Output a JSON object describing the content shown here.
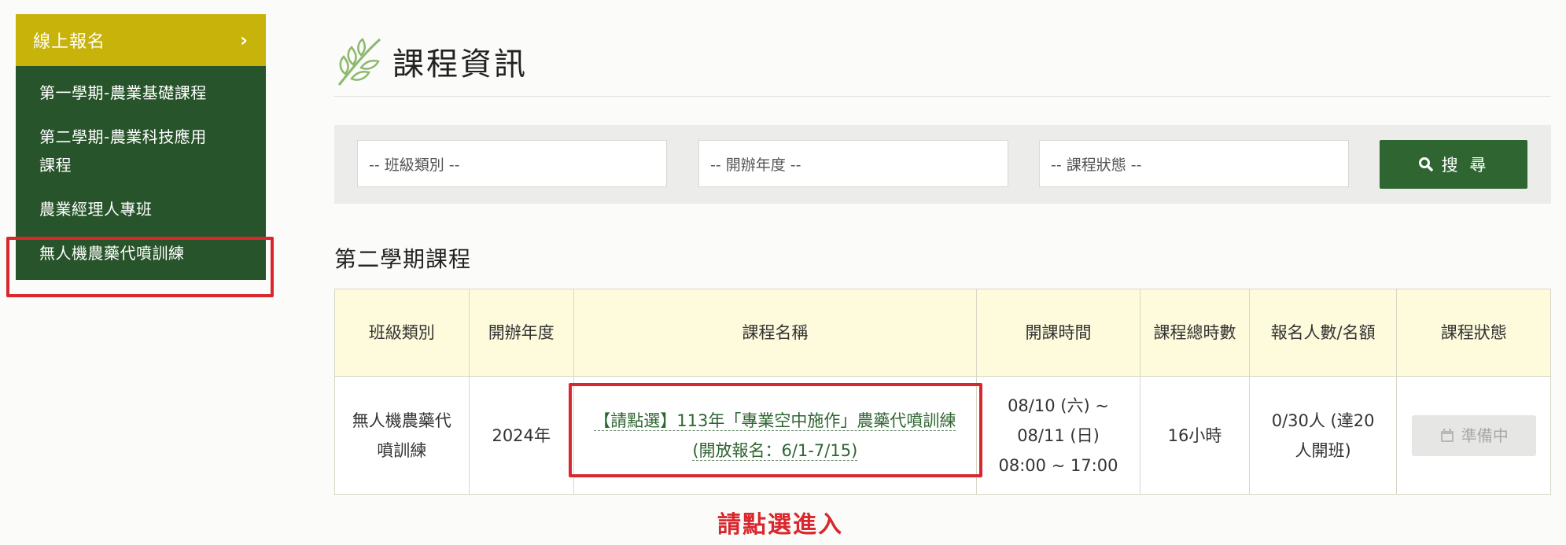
{
  "sidebar": {
    "header": "線上報名",
    "header_chevron": "›",
    "items": [
      {
        "label": "第一學期-農業基礎課程"
      },
      {
        "label": "第二學期-農業科技應用課程"
      },
      {
        "label": "農業經理人專班"
      },
      {
        "label": "無人機農藥代噴訓練"
      }
    ]
  },
  "page": {
    "title": "課程資訊",
    "title_icon": "leaf-icon"
  },
  "filters": {
    "class_type": "-- 班級類別 --",
    "year": "-- 開辦年度 --",
    "status": "-- 課程狀態 --",
    "search_label": "搜 尋",
    "search_icon": "search-icon"
  },
  "section": {
    "title": "第二學期課程"
  },
  "table": {
    "headers": [
      "班級類別",
      "開辦年度",
      "課程名稱",
      "開課時間",
      "課程總時數",
      "報名人數/名額",
      "課程狀態"
    ],
    "rows": [
      {
        "class_type": "無人機農藥代噴訓練",
        "year": "2024年",
        "course_name_line1": "【請點選】113年「專業空中施作」農藥代噴訓練",
        "course_name_line2": "(開放報名：6/1-7/15)",
        "time_line1": "08/10 (六) ~",
        "time_line2": "08/11 (日)",
        "time_line3": "08:00 ~ 17:00",
        "hours": "16小時",
        "enrollment": "0/30人 (達20人開班)",
        "status": "準備中",
        "status_icon": "calendar-icon"
      }
    ]
  },
  "annotation": {
    "note": "請點選進入"
  },
  "colors": {
    "sidebar_header": "#c8b30a",
    "sidebar_bg": "#27542a",
    "primary_green": "#2e6531",
    "highlight_red": "#d8282e",
    "table_header_bg": "#fefbdc"
  }
}
